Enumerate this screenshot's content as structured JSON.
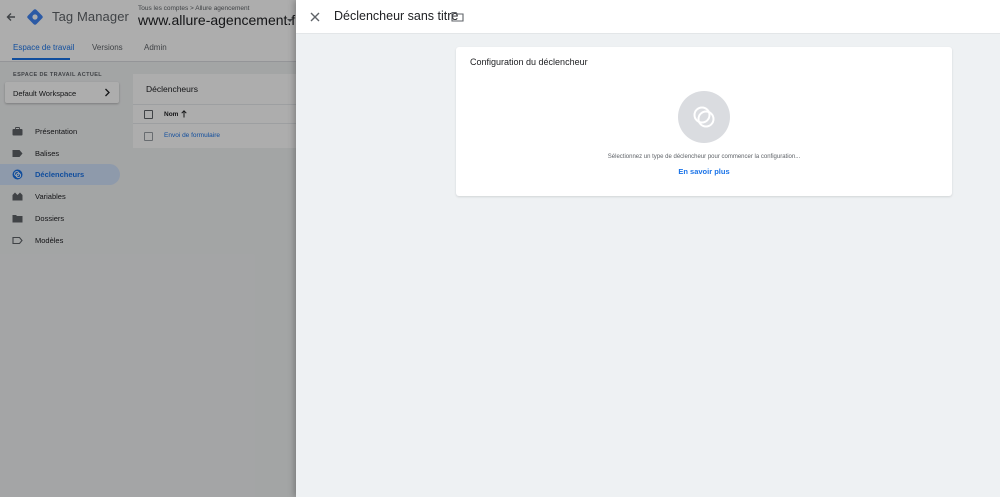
{
  "app": {
    "product_name": "Tag Manager",
    "breadcrumb": "Tous les comptes > Allure agencement",
    "container_name": "www.allure-agencement.fr",
    "accent_color": "#1a73e8"
  },
  "tabs": [
    {
      "label": "Espace de travail",
      "active": true
    },
    {
      "label": "Versions",
      "active": false
    },
    {
      "label": "Admin",
      "active": false
    }
  ],
  "workspace": {
    "section_label": "ESPACE DE TRAVAIL ACTUEL",
    "name": "Default Workspace"
  },
  "sidebar": {
    "items": [
      {
        "label": "Présentation",
        "icon": "briefcase-icon",
        "active": false
      },
      {
        "label": "Balises",
        "icon": "tag-icon",
        "active": false
      },
      {
        "label": "Déclencheurs",
        "icon": "trigger-icon",
        "active": true
      },
      {
        "label": "Variables",
        "icon": "variables-icon",
        "active": false
      },
      {
        "label": "Dossiers",
        "icon": "folder-icon",
        "active": false
      },
      {
        "label": "Modèles",
        "icon": "template-icon",
        "active": false
      }
    ]
  },
  "trigger_list": {
    "title": "Déclencheurs",
    "column_name": "Nom",
    "rows": [
      "Envoi de formulaire"
    ]
  },
  "panel": {
    "title": "Déclencheur sans titre",
    "config_title": "Configuration du déclencheur",
    "hint": "Sélectionnez un type de déclencheur pour commencer la configuration...",
    "learn_more": "En savoir plus"
  }
}
